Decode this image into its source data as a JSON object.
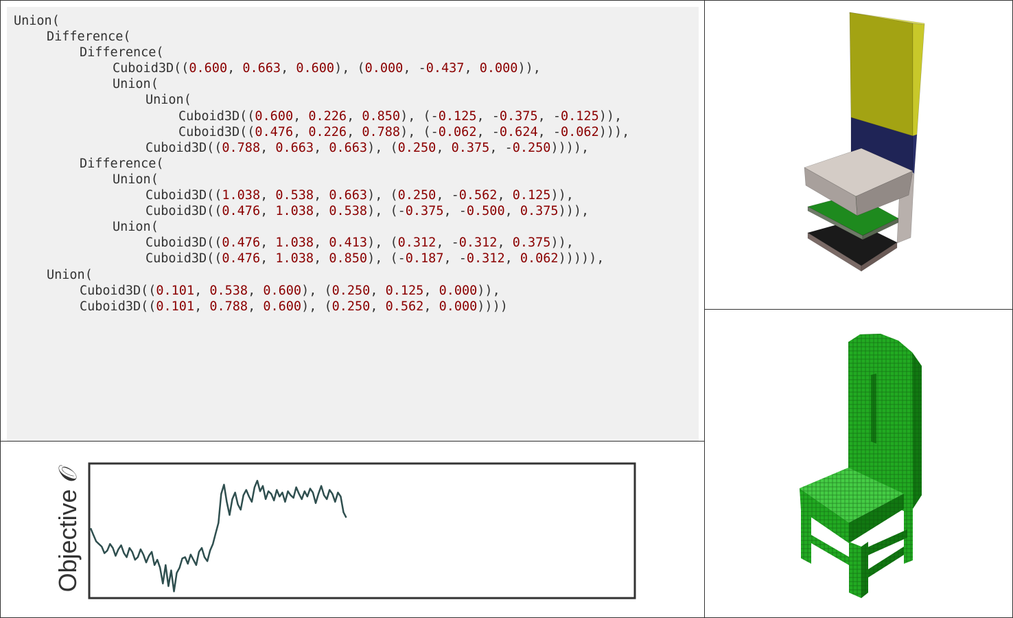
{
  "program": {
    "lines": [
      {
        "indent": 0,
        "text": "Union("
      },
      {
        "indent": 1,
        "text": "Difference("
      },
      {
        "indent": 2,
        "text": "Difference("
      },
      {
        "indent": 3,
        "text": "Cuboid3D((0.600, 0.663, 0.600), (0.000, -0.437, 0.000)),"
      },
      {
        "indent": 3,
        "text": "Union("
      },
      {
        "indent": 4,
        "text": "Union("
      },
      {
        "indent": 5,
        "text": "Cuboid3D((0.600, 0.226, 0.850), (-0.125, -0.375, -0.125)),"
      },
      {
        "indent": 5,
        "text": "Cuboid3D((0.476, 0.226, 0.788), (-0.062, -0.624, -0.062))),"
      },
      {
        "indent": 4,
        "text": "Cuboid3D((0.788, 0.663, 0.663), (0.250, 0.375, -0.250)))),"
      },
      {
        "indent": 2,
        "text": "Difference("
      },
      {
        "indent": 3,
        "text": "Union("
      },
      {
        "indent": 4,
        "text": "Cuboid3D((1.038, 0.538, 0.663), (0.250, -0.562, 0.125)),"
      },
      {
        "indent": 4,
        "text": "Cuboid3D((0.476, 1.038, 0.538), (-0.375, -0.500, 0.375))),"
      },
      {
        "indent": 3,
        "text": "Union("
      },
      {
        "indent": 4,
        "text": "Cuboid3D((0.476, 1.038, 0.413), (0.312, -0.312, 0.375)),"
      },
      {
        "indent": 4,
        "text": "Cuboid3D((0.476, 1.038, 0.850), (-0.187, -0.312, 0.062))))),"
      },
      {
        "indent": 1,
        "text": "Union("
      },
      {
        "indent": 2,
        "text": "Cuboid3D((0.101, 0.538, 0.600), (0.250, 0.125, 0.000)),"
      },
      {
        "indent": 2,
        "text": "Cuboid3D((0.101, 0.788, 0.600), (0.250, 0.562, 0.000))))"
      }
    ]
  },
  "objective_plot": {
    "ylabel": "Objective 𝒪",
    "line_color": "#2f4f4f",
    "chart_data": {
      "type": "line",
      "y": [
        0.52,
        0.47,
        0.42,
        0.4,
        0.38,
        0.33,
        0.35,
        0.4,
        0.37,
        0.31,
        0.36,
        0.39,
        0.33,
        0.3,
        0.37,
        0.34,
        0.28,
        0.3,
        0.36,
        0.32,
        0.26,
        0.31,
        0.34,
        0.24,
        0.28,
        0.22,
        0.1,
        0.24,
        0.08,
        0.2,
        0.04,
        0.18,
        0.22,
        0.29,
        0.3,
        0.25,
        0.32,
        0.28,
        0.24,
        0.34,
        0.37,
        0.3,
        0.27,
        0.35,
        0.4,
        0.48,
        0.56,
        0.78,
        0.85,
        0.72,
        0.62,
        0.74,
        0.79,
        0.7,
        0.66,
        0.77,
        0.81,
        0.76,
        0.72,
        0.83,
        0.88,
        0.8,
        0.84,
        0.74,
        0.8,
        0.78,
        0.73,
        0.81,
        0.76,
        0.79,
        0.72,
        0.8,
        0.77,
        0.75,
        0.83,
        0.78,
        0.74,
        0.8,
        0.76,
        0.82,
        0.79,
        0.71,
        0.78,
        0.84,
        0.77,
        0.74,
        0.81,
        0.78,
        0.72,
        0.79,
        0.76,
        0.64,
        0.6
      ],
      "x_total_steps": 420
    }
  },
  "render_top": {
    "colors": {
      "back_front": "#a3a313",
      "back_side": "#c8c82a",
      "back_top": "#e0e05a",
      "navy": "#1f2456",
      "navy_side": "#2a2f6a",
      "seat_top": "#d4ccc6",
      "seat_front": "#a8a09c",
      "seat_side": "#928a86",
      "green_shelf": "#1e8a1e",
      "dark_shelf": "#1a1a1a",
      "leg": "#b8b0ac"
    }
  },
  "render_bottom": {
    "colors": {
      "chair_green": "#22aa22",
      "chair_dark": "#117711",
      "chair_light": "#44cc44",
      "voxel_grid": "#0a4a0a"
    }
  }
}
